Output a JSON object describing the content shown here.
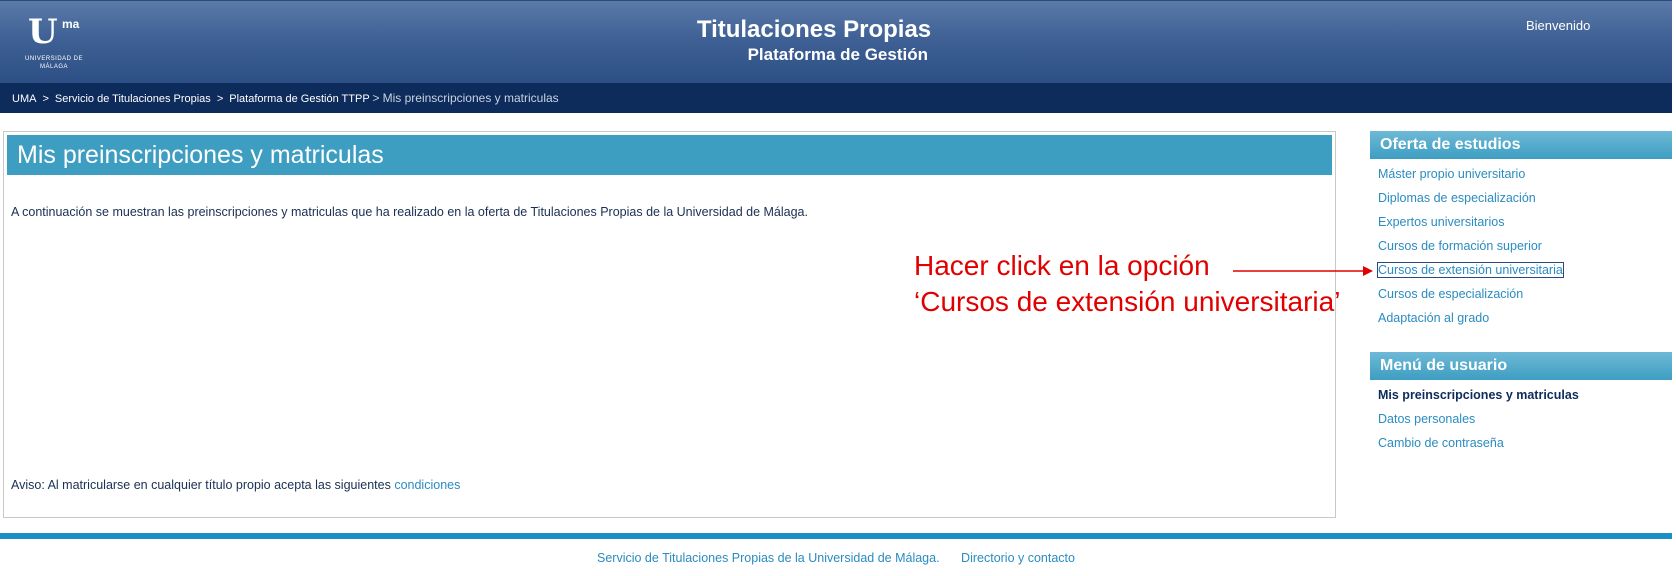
{
  "header": {
    "logo_mark": "U",
    "logo_sup": "ma",
    "logo_text": "UNIVERSIDAD DE MÁLAGA",
    "title": "Titulaciones Propias",
    "subtitle": "Plataforma de Gestión",
    "welcome": "Bienvenido"
  },
  "breadcrumb": {
    "items": [
      "UMA",
      "Servicio de Titulaciones Propias",
      "Plataforma de Gestión TTPP"
    ],
    "separator": ">",
    "current": "Mis preinscripciones y matriculas"
  },
  "main": {
    "title": "Mis preinscripciones y matriculas",
    "intro": "A continuación se muestran las preinscripciones y matriculas que ha realizado en la oferta de Titulaciones Propias de la Universidad de Málaga.",
    "aviso_text": "Aviso: Al matricularse en cualquier título propio acepta las siguientes",
    "aviso_link": "condiciones"
  },
  "annotation": {
    "line1": "Hacer click en la opción",
    "line2": "‘Cursos de extensión universitaria’",
    "color": "#e00000"
  },
  "sidebar": {
    "oferta_title": "Oferta de estudios",
    "oferta_items": [
      "Máster propio universitario",
      "Diplomas de especialización",
      "Expertos universitarios",
      "Cursos de formación superior",
      "Cursos de extensión universitaria",
      "Cursos de especialización",
      "Adaptación al grado"
    ],
    "menu_title": "Menú de usuario",
    "menu_items": [
      "Mis preinscripciones y matriculas",
      "Datos personales",
      "Cambio de contraseña"
    ]
  },
  "footer": {
    "link1": "Servicio de Titulaciones Propias de la Universidad de Málaga.",
    "link2": "Directorio y contacto"
  },
  "colors": {
    "header_blue": "#2c4f85",
    "breadcrumb_navy": "#0d2b5b",
    "accent": "#3d9ec1",
    "link": "#2a8cc0"
  }
}
